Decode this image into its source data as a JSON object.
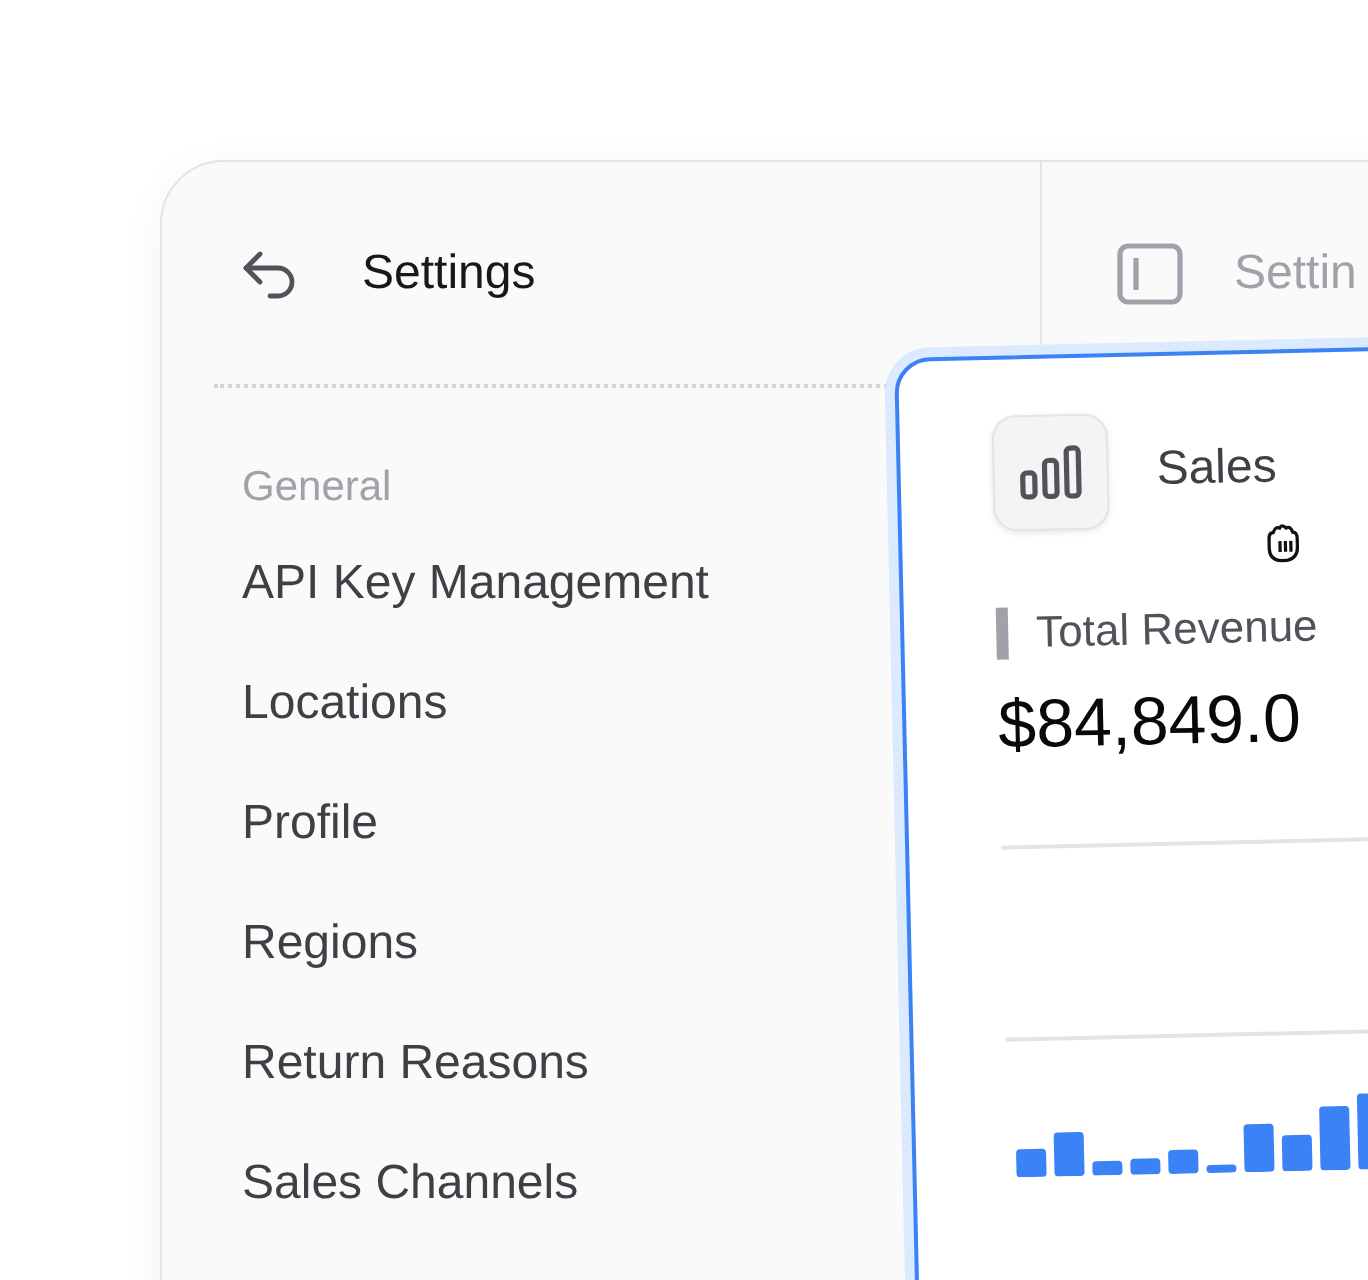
{
  "sidebar": {
    "title": "Settings",
    "section": "General",
    "items": [
      "API Key Management",
      "Locations",
      "Profile",
      "Regions",
      "Return Reasons",
      "Sales Channels"
    ]
  },
  "main": {
    "header_title": "Settin"
  },
  "card": {
    "title": "Sales",
    "metric_label": "Total Revenue",
    "metric_value": "$84,849.0"
  }
}
